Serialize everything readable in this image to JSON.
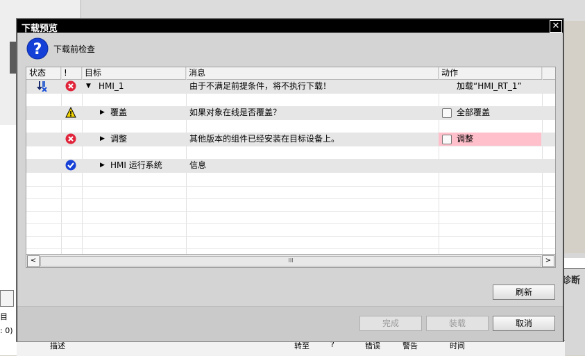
{
  "dialog": {
    "title": "下载预览",
    "close_glyph": "✕",
    "header_text": "下载前检查"
  },
  "columns": [
    "状态",
    "!",
    "目标",
    "消息",
    "动作"
  ],
  "rows": [
    {
      "status_icon": "download-error-icon",
      "severity_icon": "error-icon",
      "expander": "▼",
      "target": "HMI_1",
      "message": "由于不满足前提条件，将不执行下载！",
      "action": "加载“HMI_RT_1”"
    },
    {
      "severity_icon": "warning-icon",
      "expander": "▶",
      "target": "覆盖",
      "message": "如果对象在线是否覆盖？",
      "action": "全部覆盖",
      "action_checked": false
    },
    {
      "severity_icon": "error-icon",
      "expander": "▶",
      "target": "调整",
      "message": "其他版本的组件已经安装在目标设备上。",
      "action": "调整",
      "action_checked": false,
      "action_highlight": "#ffc0cb"
    },
    {
      "severity_icon": "ok-check-icon",
      "expander": "▶",
      "target": "HMI 运行系统",
      "message": "信息",
      "action": ""
    }
  ],
  "scrollbar": {
    "left": "<",
    "right": ">",
    "grip": "III"
  },
  "buttons": {
    "refresh": "刷新",
    "finish": "完成",
    "load": "装载",
    "cancel": "取消"
  },
  "background": {
    "diag_label": "诊断",
    "footer_cols": [
      "描述",
      "转至",
      "?",
      "错误",
      "警告",
      "时间"
    ],
    "left_text_1": "目",
    "left_text_2": ": 0)"
  },
  "colors": {
    "error": "#e0243a",
    "warning": "#f2d400",
    "info": "#1640d6",
    "highlight": "#ffc0cb"
  }
}
